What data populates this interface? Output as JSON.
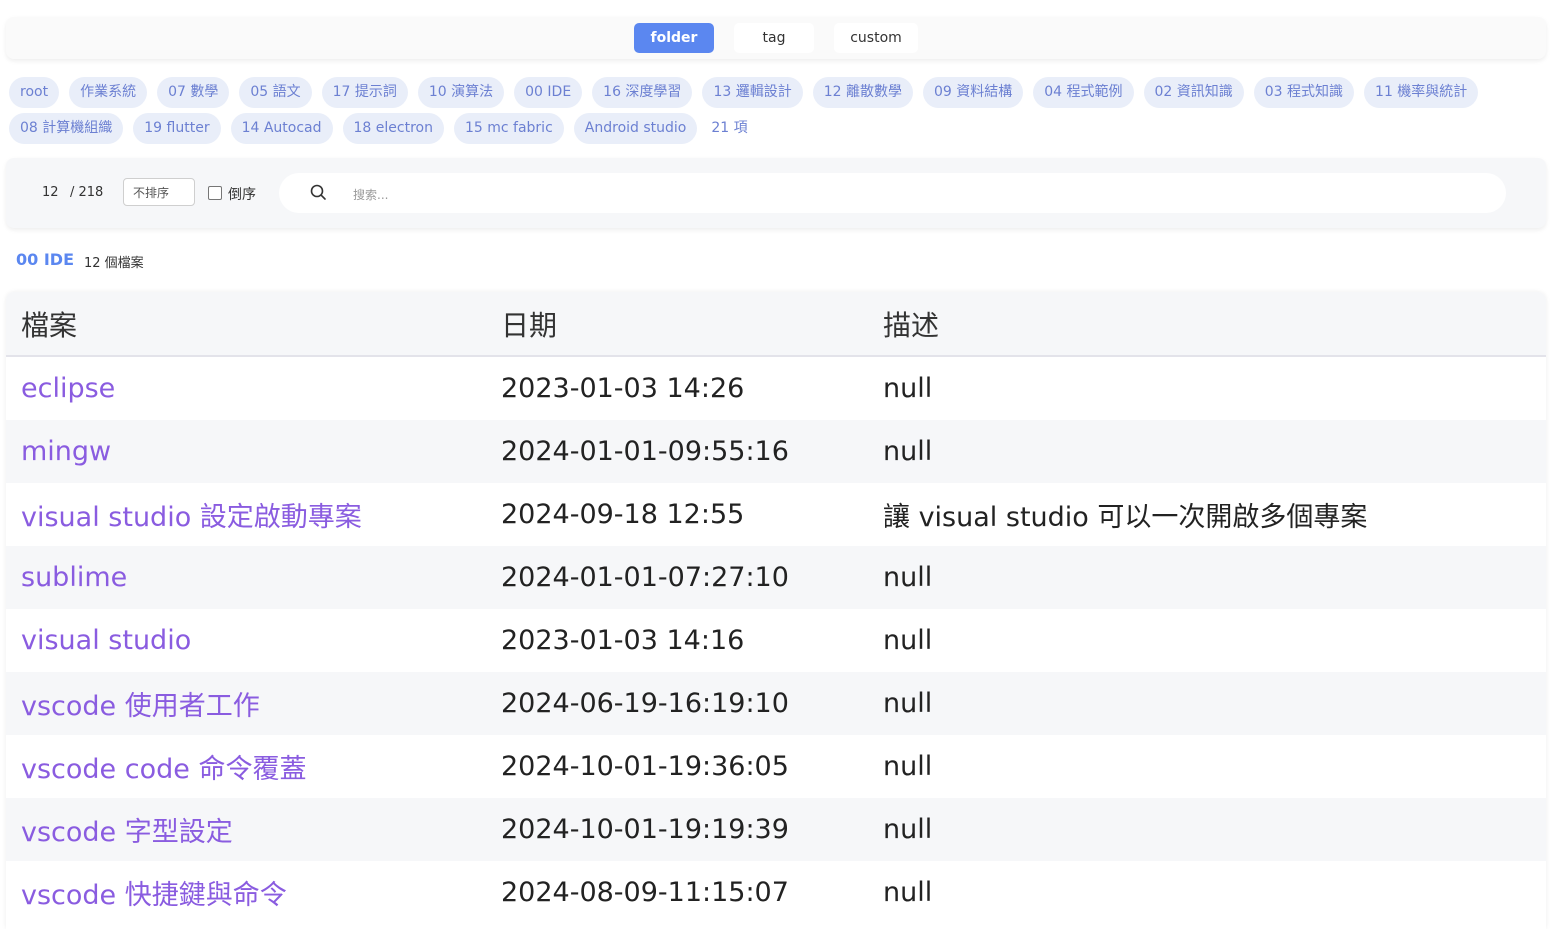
{
  "mode_tabs": [
    {
      "label": "folder",
      "active": true
    },
    {
      "label": "tag",
      "active": false
    },
    {
      "label": "custom",
      "active": false
    }
  ],
  "folders": [
    "root",
    "作業系統",
    "07 數學",
    "05 語文",
    "17 提示詞",
    "10 演算法",
    "00 IDE",
    "16 深度學習",
    "13 邏輯設計",
    "12 離散數學",
    "09 資料結構",
    "04 程式範例",
    "02 資訊知識",
    "03 程式知識",
    "11 機率與統計",
    "08 計算機組織",
    "19 flutter",
    "14 Autocad",
    "18 electron",
    "15 mc fabric",
    "Android studio"
  ],
  "folder_count_label": "21 項",
  "controls": {
    "page_current": "12",
    "page_total": "/ 218",
    "sort_value": "不排序",
    "reverse_label": "倒序",
    "reverse_checked": false,
    "search_placeholder": "搜索..."
  },
  "current_folder": {
    "name": "00 IDE",
    "file_count": "12 個檔案"
  },
  "table": {
    "headers": [
      "檔案",
      "日期",
      "描述"
    ],
    "rows": [
      {
        "name": "eclipse",
        "date": "2023-01-03 14:26",
        "desc": "null"
      },
      {
        "name": "mingw",
        "date": "2024-01-01-09:55:16",
        "desc": "null"
      },
      {
        "name": "visual studio 設定啟動專案",
        "date": "2024-09-18 12:55",
        "desc": "讓 visual studio 可以一次開啟多個專案"
      },
      {
        "name": "sublime",
        "date": "2024-01-01-07:27:10",
        "desc": "null"
      },
      {
        "name": "visual studio",
        "date": "2023-01-03 14:16",
        "desc": "null"
      },
      {
        "name": "vscode 使用者工作",
        "date": "2024-06-19-16:19:10",
        "desc": "null"
      },
      {
        "name": "vscode code 命令覆蓋",
        "date": "2024-10-01-19:36:05",
        "desc": "null"
      },
      {
        "name": "vscode 字型設定",
        "date": "2024-10-01-19:19:39",
        "desc": "null"
      },
      {
        "name": "vscode 快捷鍵與命令",
        "date": "2024-08-09-11:15:07",
        "desc": "null"
      }
    ]
  },
  "colors": {
    "accent": "#5b87f0",
    "chip_bg": "#e9eef9",
    "chip_text": "#6c80d2",
    "file_link": "#8a5ce0"
  }
}
